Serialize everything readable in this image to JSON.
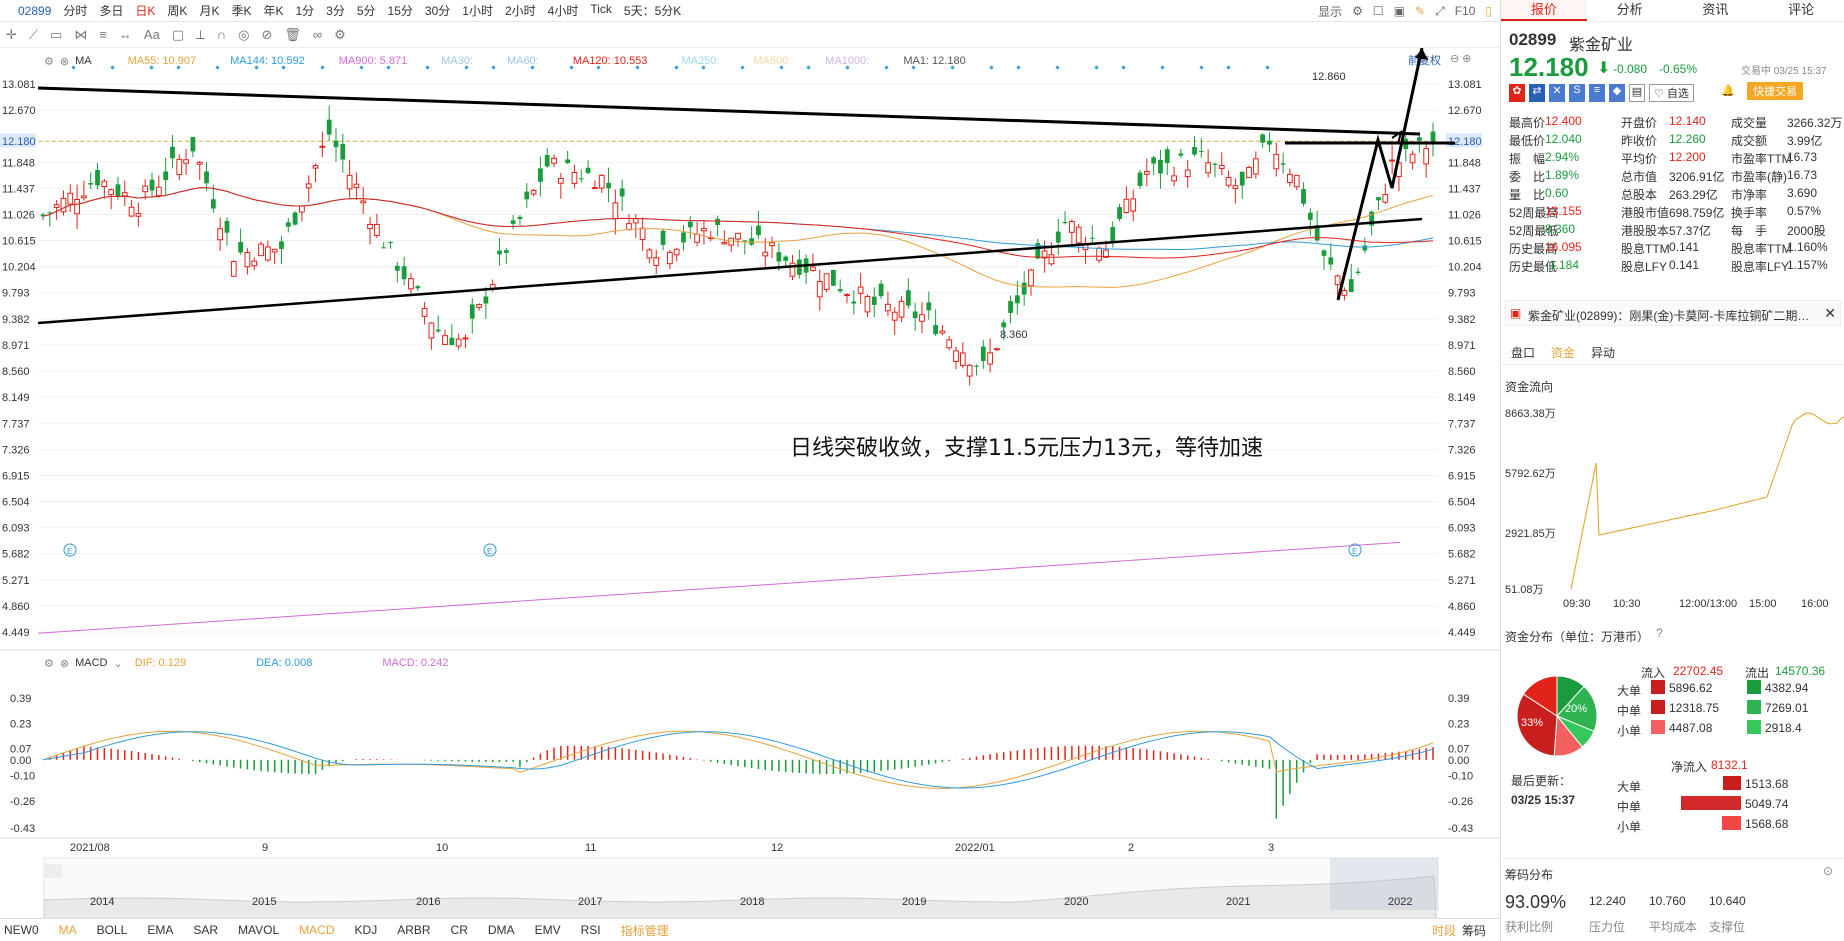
{
  "topbar": {
    "code": "02899",
    "periods": [
      "分时",
      "多日",
      "日K",
      "周K",
      "月K",
      "季K",
      "年K",
      "1分",
      "3分",
      "5分",
      "15分",
      "30分",
      "1小时",
      "2小时",
      "4小时",
      "Tick",
      "5天：5分K"
    ],
    "active_index": 2,
    "right_items": [
      "显示"
    ]
  },
  "toolbar": {
    "text_tool": "Aa"
  },
  "main": {
    "indicator": "MA",
    "ma_labels": [
      {
        "text": "MA55: 10.907",
        "color": "#e6a23c"
      },
      {
        "text": "MA144: 10.592",
        "color": "#2d9cdb"
      },
      {
        "text": "MA900: 5.871",
        "color": "#d46bd8"
      },
      {
        "text": "MA30:",
        "color": "#9fc6e8"
      },
      {
        "text": "MA60:",
        "color": "#9fc6e8"
      },
      {
        "text": "MA120: 10.553",
        "color": "#e2231a"
      },
      {
        "text": "MA250:",
        "color": "#9fd8f3"
      },
      {
        "text": "MA500:",
        "color": "#f5d7a6"
      },
      {
        "text": "MA1000:",
        "color": "#c9b6e8"
      },
      {
        "text": "MA1: 12.180",
        "color": "#555555"
      }
    ],
    "fuquan": "前复权",
    "y_ticks": [
      "13.081",
      "12.670",
      "12.180",
      "11.848",
      "11.437",
      "11.026",
      "10.615",
      "10.204",
      "9.793",
      "9.382",
      "8.971",
      "8.560",
      "8.149",
      "7.737",
      "7.326",
      "6.915",
      "6.504",
      "6.093",
      "5.682",
      "5.271",
      "4.860",
      "4.449"
    ],
    "high_label": "12.860",
    "low_label": "8.360",
    "annotation": "日线突破收敛，支撑11.5元压力13元，等待加速"
  },
  "macd": {
    "name": "MACD",
    "labels": [
      {
        "text": "DIF: 0.129",
        "color": "#e6a23c"
      },
      {
        "text": "DEA: 0.008",
        "color": "#2d9cdb"
      },
      {
        "text": "MACD: 0.242",
        "color": "#d46bd8"
      }
    ],
    "y_ticks": [
      "0.39",
      "0.23",
      "0.07",
      "0.00",
      "-0.10",
      "-0.26",
      "-0.43"
    ]
  },
  "x_labels": [
    "2021/08",
    "9",
    "10",
    "11",
    "12",
    "2022/01",
    "2",
    "3"
  ],
  "overview_years": [
    "2014",
    "2015",
    "2016",
    "2017",
    "2018",
    "2019",
    "2020",
    "2021",
    "2022"
  ],
  "indicator_tabs": [
    "NEW0",
    "MA",
    "BOLL",
    "EMA",
    "SAR",
    "MAVOL",
    "MACD",
    "KDJ",
    "ARBR",
    "CR",
    "DMA",
    "EMV",
    "RSI",
    "指标管理"
  ],
  "indicator_active": [
    "MA",
    "MACD"
  ],
  "bottom_right": [
    "时段",
    "筹码"
  ],
  "panel": {
    "tabs": [
      "报价",
      "分析",
      "资讯",
      "评论"
    ],
    "code": "02899",
    "name": "紫金矿业",
    "price": "12.180",
    "arrow": "⬇",
    "change": "-0.080",
    "pct": "-0.65%",
    "status": "交易中 03/25 15:37",
    "watch": "自选",
    "quick_trade": "快捷交易",
    "stats": [
      [
        "最高价",
        "12.400",
        "开盘价",
        "12.140",
        "成交量",
        "3266.32万"
      ],
      [
        "最低价",
        "12.040",
        "昨收价",
        "12.260",
        "成交额",
        "3.99亿"
      ],
      [
        "振　幅",
        "2.94%",
        "平均价",
        "12.200",
        "市盈率TTM",
        "16.73"
      ],
      [
        "委　比",
        "1.89%",
        "总市值",
        "3206.91亿",
        "市盈率(静)",
        "16.73"
      ],
      [
        "量　比",
        "0.60",
        "总股本",
        "263.29亿",
        "市净率",
        "3.690"
      ],
      [
        "52周最高",
        "13.155",
        "港股市值",
        "698.759亿",
        "换手率",
        "0.57%"
      ],
      [
        "52周最低",
        "8.360",
        "港股股本",
        "57.37亿",
        "每　手",
        "2000股"
      ],
      [
        "历史最高",
        "16.095",
        "股息TTM",
        "0.141",
        "股息率TTM",
        "1.160%"
      ],
      [
        "历史最低",
        "-1.184",
        "股息LFY",
        "0.141",
        "股息率LFY",
        "1.157%"
      ]
    ],
    "news": "紫金矿业(02899)：刚果(金)卡莫阿-卡库拉铜矿二期…",
    "subtabs": [
      "盘口",
      "资金",
      "异动"
    ],
    "subtab_active": 1,
    "flow_title": "资金流向",
    "flow_y": [
      "8663.38万",
      "5792.62万",
      "2921.85万",
      "51.08万"
    ],
    "flow_x": [
      "09:30",
      "10:30",
      "12:00/13:00",
      "15:00",
      "16:00"
    ],
    "dist_title": "资金分布（单位：万港币）",
    "inflow_label": "流入",
    "inflow": "22702.45",
    "outflow_label": "流出",
    "outflow": "14570.36",
    "pie_labels": [
      "33%",
      "20%"
    ],
    "dist_rows": [
      {
        "label": "大单",
        "in": "5896.62",
        "out": "4382.94"
      },
      {
        "label": "中单",
        "in": "12318.75",
        "out": "7269.01"
      },
      {
        "label": "小单",
        "in": "4487.08",
        "out": "2918.4"
      }
    ],
    "net_label": "净流入",
    "net": "8132.1",
    "last_update_label": "最后更新：",
    "last_update": "03/25 15:37",
    "net_rows": [
      {
        "label": "大单",
        "value": "1513.68"
      },
      {
        "label": "中单",
        "value": "5049.74"
      },
      {
        "label": "小单",
        "value": "1568.68"
      }
    ],
    "chips_title": "筹码分布",
    "chips": [
      {
        "value": "93.09%",
        "label": "获利比例"
      },
      {
        "value": "12.240",
        "label": "压力位"
      },
      {
        "value": "10.760",
        "label": "平均成本"
      },
      {
        "value": "10.640",
        "label": "支撑位"
      }
    ]
  }
}
